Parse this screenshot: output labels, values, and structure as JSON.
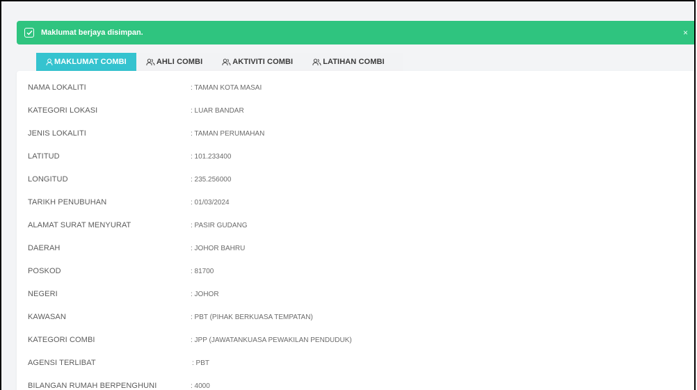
{
  "alert": {
    "message": "Maklumat berjaya disimpan.",
    "close_glyph": "×",
    "color": "#2fc47f"
  },
  "tabs": [
    {
      "label": "MAKLUMAT COMBI",
      "icon": "user-icon",
      "active": true
    },
    {
      "label": "AHLI COMBI",
      "icon": "users-icon",
      "active": false
    },
    {
      "label": "AKTIVITI COMBI",
      "icon": "users-icon",
      "active": false
    },
    {
      "label": "LATIHAN COMBI",
      "icon": "users-icon",
      "active": false
    }
  ],
  "accent_color": "#35c3cf",
  "details": [
    {
      "label": "NAMA LOKALITI",
      "value": ": TAMAN KOTA MASAI"
    },
    {
      "label": "KATEGORI LOKASI",
      "value": ": LUAR BANDAR"
    },
    {
      "label": "JENIS LOKALITI",
      "value": ": TAMAN PERUMAHAN"
    },
    {
      "label": "LATITUD",
      "value": ": 101.233400"
    },
    {
      "label": "LONGITUD",
      "value": ": 235.256000"
    },
    {
      "label": "TARIKH PENUBUHAN",
      "value": ": 01/03/2024"
    },
    {
      "label": "ALAMAT SURAT MENYURAT",
      "value": ": PASIR GUDANG"
    },
    {
      "label": "DAERAH",
      "value": ": JOHOR BAHRU"
    },
    {
      "label": "POSKOD",
      "value": ": 81700"
    },
    {
      "label": "NEGERI",
      "value": ": JOHOR"
    },
    {
      "label": "KAWASAN",
      "value": ": PBT (PIHAK BERKUASA TEMPATAN)"
    },
    {
      "label": "KATEGORI COMBI",
      "value": ": JPP (JAWATANKUASA PEWAKILAN PENDUDUK)"
    },
    {
      "label": "AGENSI TERLIBAT",
      "value": ": PBT"
    },
    {
      "label": "BILANGAN RUMAH BERPENGHUNI",
      "value": ": 4000"
    }
  ]
}
